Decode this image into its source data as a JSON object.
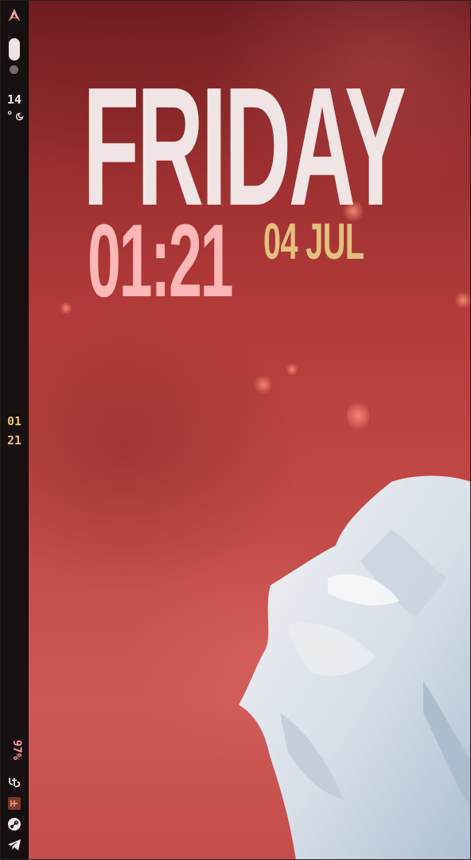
{
  "bar": {
    "launcher_icon": "arch-linux-icon",
    "workspace_active": 1,
    "weather": {
      "temperature": "14",
      "unit": "°",
      "icon": "moon-cloud-icon"
    },
    "clock": {
      "hour": "01",
      "minute": "21"
    },
    "tray": {
      "battery": "97%",
      "icons": [
        "network-icon",
        "keyboard-icon",
        "steam-icon",
        "telegram-icon"
      ]
    }
  },
  "desktop_clock": {
    "day": "FRIDAY",
    "time": "01:21",
    "date": "04 JUL"
  },
  "colors": {
    "day": "#f1e4e4",
    "time": "#ffb6b6",
    "date": "#e3c07e",
    "bar_clock": "#e8c27a",
    "battery": "#ff9a9a"
  }
}
